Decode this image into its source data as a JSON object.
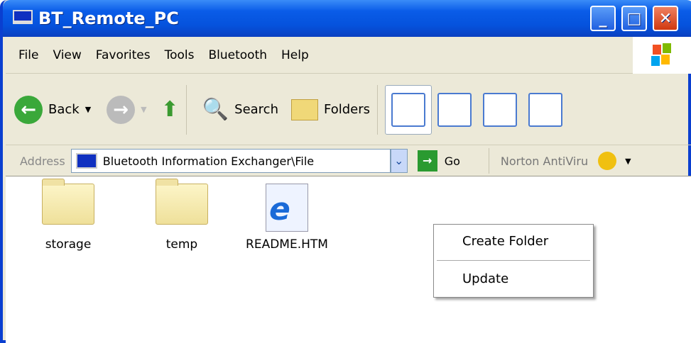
{
  "window": {
    "title": "BT_Remote_PC"
  },
  "menu": [
    "File",
    "View",
    "Favorites",
    "Tools",
    "Bluetooth",
    "Help"
  ],
  "toolbar": {
    "back": "Back",
    "search": "Search",
    "folders": "Folders"
  },
  "address": {
    "label": "Address",
    "value": "Bluetooth Information Exchanger\\File",
    "go": "Go",
    "norton": "Norton AntiViru"
  },
  "files": [
    {
      "name": "storage",
      "type": "folder"
    },
    {
      "name": "temp",
      "type": "folder"
    },
    {
      "name": "README.HTM",
      "type": "html"
    }
  ],
  "context_menu": [
    "Create Folder",
    "Update"
  ]
}
